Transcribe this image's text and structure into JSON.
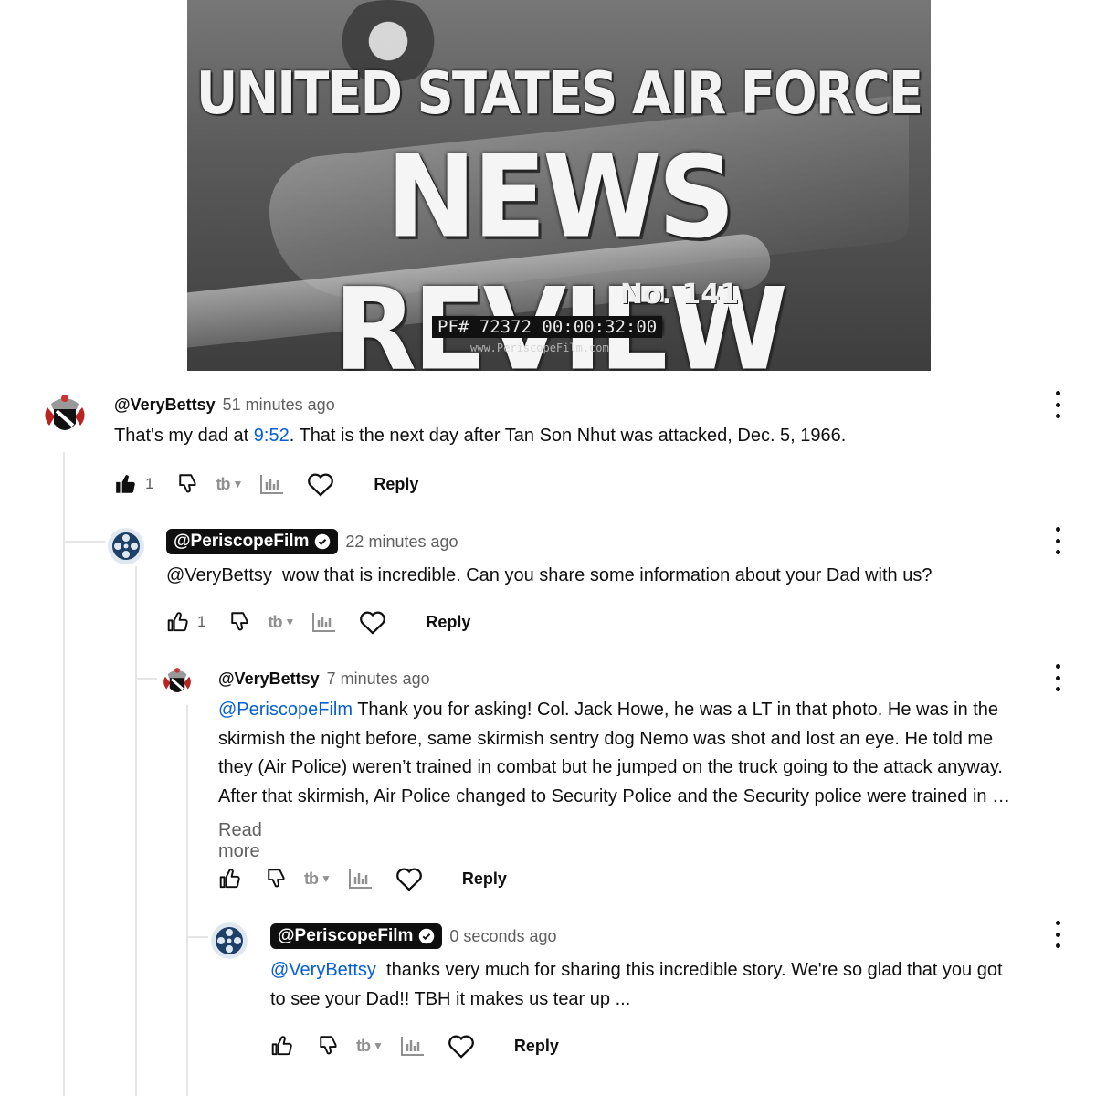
{
  "video": {
    "title_line1": "UNITED STATES AIR FORCE",
    "title_line2": "NEWS REVIEW",
    "issue": "No. 141",
    "timecode": "PF# 72372 00:00:32:00",
    "watermark": "www.PeriscopeFilm.com"
  },
  "comments": [
    {
      "author": "@VeryBettsy",
      "time": "51 minutes ago",
      "text_before": "That's my dad at ",
      "timestamp_link": "9:52",
      "text_after": ". That is the next day after Tan Son Nhut was attacked, Dec. 5, 1966.",
      "likes": "1",
      "liked": true,
      "reply_label": "Reply",
      "avatar_icon": "family-crest-icon"
    },
    {
      "author": "@PeriscopeFilm",
      "verified": true,
      "time": "22 minutes ago",
      "text": "@VeryBettsy  wow that is incredible. Can you share some information about your Dad with us?",
      "likes": "1",
      "reply_label": "Reply",
      "avatar_icon": "film-reel-icon"
    },
    {
      "author": "@VeryBettsy",
      "time": "7 minutes ago",
      "mention": "@PeriscopeFilm",
      "line1": " Thank you for asking! Col. Jack Howe, he was a LT in that photo. He was in the",
      "line2": "skirmish the night before, same skirmish sentry dog Nemo was shot and lost an eye. He told me",
      "line3": "they (Air Police) weren’t trained in combat but he jumped on the truck going to the attack anyway.",
      "line4": "After that skirmish, Air Police changed to Security Police and the Security police were trained in …",
      "read_more": "Read more",
      "reply_label": "Reply",
      "avatar_icon": "family-crest-icon"
    },
    {
      "author": "@PeriscopeFilm",
      "verified": true,
      "time": "0 seconds ago",
      "mention": "@VeryBettsy",
      "line1": "  thanks very much for sharing this incredible story. We're so glad that you got",
      "line2": "to see your Dad!! TBH it makes us tear up ...",
      "reply_label": "Reply",
      "avatar_icon": "film-reel-icon"
    }
  ],
  "toolbar_icons": [
    "thumbs-up-icon",
    "thumbs-down-icon",
    "tubebuddy-icon",
    "analytics-icon",
    "heart-icon"
  ],
  "colors": {
    "link": "#065fd4",
    "secondary_text": "#606060",
    "text": "#0f0f0f"
  }
}
